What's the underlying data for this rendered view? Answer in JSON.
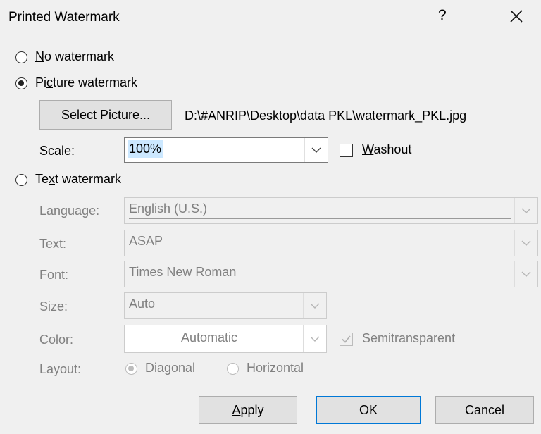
{
  "dialog": {
    "title": "Printed Watermark",
    "help_icon": "?",
    "close_icon": "close-icon"
  },
  "options": {
    "no_watermark": {
      "pre": "",
      "key": "N",
      "post": "o watermark",
      "selected": false
    },
    "picture_watermark": {
      "pre": "Pi",
      "key": "c",
      "post": "ture watermark",
      "selected": true
    },
    "text_watermark": {
      "pre": "Te",
      "key": "x",
      "post": "t watermark",
      "selected": false
    }
  },
  "picture": {
    "select_button": {
      "pre": "Select ",
      "key": "P",
      "post": "icture..."
    },
    "path": "D:\\#ANRIP\\Desktop\\data PKL\\watermark_PKL.jpg",
    "scale_label": "Scale:",
    "scale_value": "100%",
    "washout": {
      "pre": "",
      "key": "W",
      "post": "ashout",
      "checked": false
    }
  },
  "text": {
    "language_label": "Language:",
    "language_value": "English (U.S.)",
    "text_label": "Text:",
    "text_value": "ASAP",
    "font_label": "Font:",
    "font_value": "Times New Roman",
    "size_label": "Size:",
    "size_value": "Auto",
    "color_label": "Color:",
    "color_value": "Automatic",
    "semitransparent": {
      "label": "Semitransparent",
      "checked": true
    },
    "layout_label": "Layout:",
    "layout_options": [
      {
        "label": "Diagonal",
        "selected": true
      },
      {
        "label": "Horizontal",
        "selected": false
      }
    ]
  },
  "buttons": {
    "apply": {
      "pre": "",
      "key": "A",
      "post": "pply"
    },
    "ok": "OK",
    "cancel": "Cancel"
  }
}
